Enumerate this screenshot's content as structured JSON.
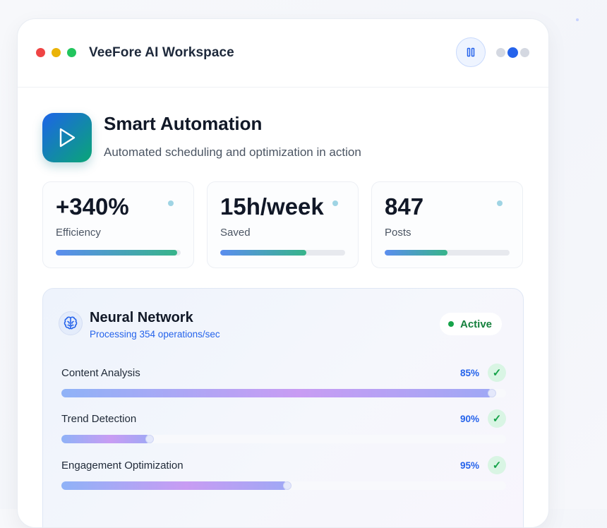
{
  "window": {
    "title": "VeeFore AI Workspace",
    "pager_active_index": 1,
    "pager_count": 3
  },
  "hero": {
    "title": "Smart Automation",
    "subtitle": "Automated scheduling and optimization in action"
  },
  "stats": [
    {
      "value": "+340%",
      "label": "Efficiency",
      "progress": 0.97
    },
    {
      "value": "15h/week",
      "label": "Saved",
      "progress": 0.69
    },
    {
      "value": "847",
      "label": "Posts",
      "progress": 0.5
    }
  ],
  "panel": {
    "title": "Neural Network",
    "subtitle": "Processing 354 operations/sec",
    "status": "Active",
    "rows": [
      {
        "label": "Content Analysis",
        "percent": "85%",
        "check": "✓",
        "progress": 0.97
      },
      {
        "label": "Trend Detection",
        "percent": "90%",
        "check": "✓",
        "progress": 0.2
      },
      {
        "label": "Engagement Optimization",
        "percent": "95%",
        "check": "✓",
        "progress": 0.51
      }
    ]
  },
  "colors": {
    "accent": "#2563eb",
    "success": "#16a34a",
    "traffic_red": "#ef4444",
    "traffic_yellow": "#eab308",
    "traffic_green": "#22c55e"
  },
  "icons": {
    "pause": "pause-icon",
    "play": "play-icon",
    "brain": "brain-icon",
    "check": "check-icon"
  }
}
